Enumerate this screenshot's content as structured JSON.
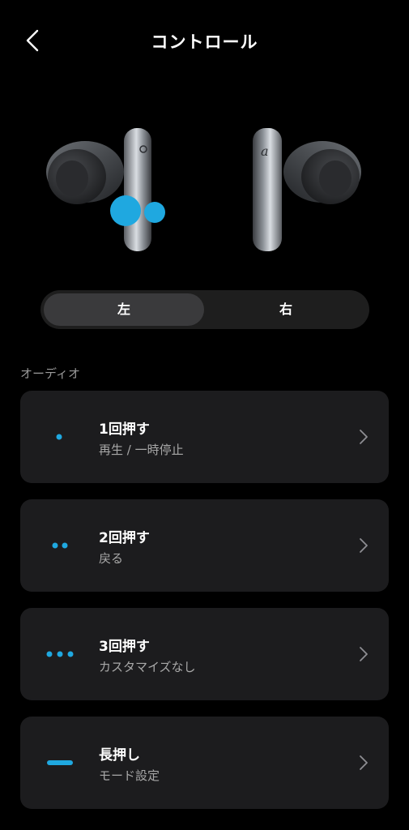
{
  "header": {
    "title": "コントロール"
  },
  "side_selector": {
    "left_label": "左",
    "right_label": "右",
    "selected": "左"
  },
  "section": {
    "label": "オーディオ"
  },
  "controls": [
    {
      "title": "1回押す",
      "subtitle": "再生 / 一時停止",
      "icon": "single-dot-icon"
    },
    {
      "title": "2回押す",
      "subtitle": "戻る",
      "icon": "double-dot-icon"
    },
    {
      "title": "3回押す",
      "subtitle": "カスタマイズなし",
      "icon": "triple-dot-icon"
    },
    {
      "title": "長押し",
      "subtitle": "モード設定",
      "icon": "long-press-bar-icon"
    }
  ],
  "colors": {
    "accent": "#1fa8e0",
    "background": "#000000",
    "card": "#1c1c1e"
  }
}
